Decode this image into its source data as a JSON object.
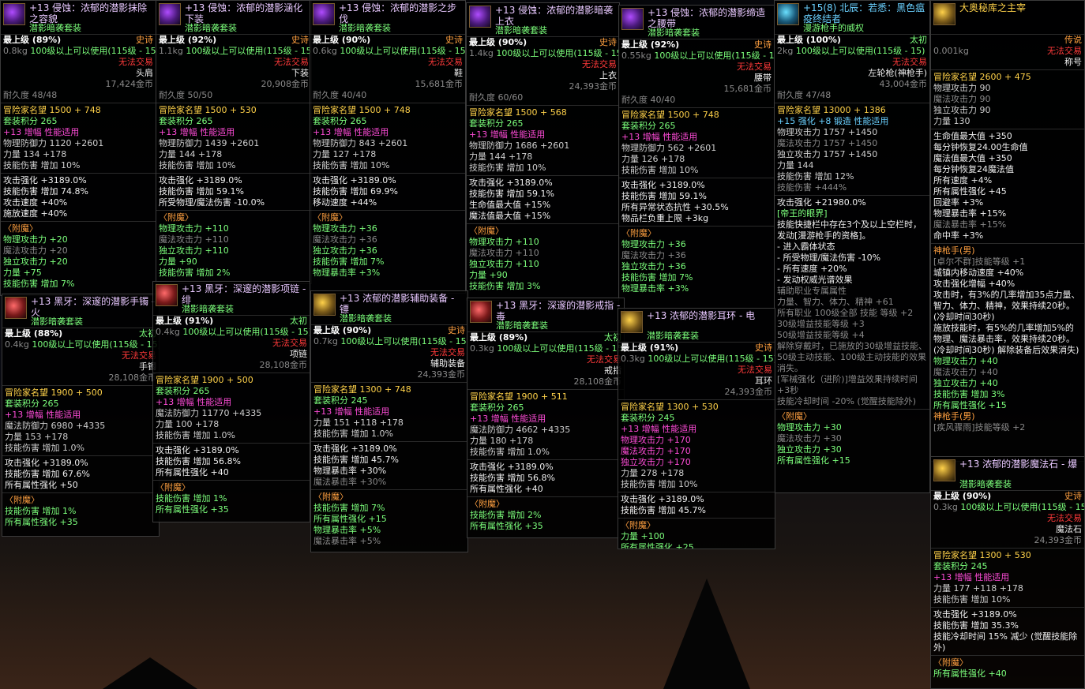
{
  "tooltips": [
    {
      "title": "+13 侵蚀：浓郁的潜影抹除之容貌",
      "set": "潜影暗袭套装",
      "rarity": "史诗",
      "grade": "最上级 (89%)",
      "weight": "0.8kg",
      "req": "100级以上可以使用(115级 - 15)",
      "trade": "无法交易",
      "slot": "头肩",
      "price": "17,424金币",
      "durability": "耐久度 48/48",
      "fame": "冒险家名望 1500 + 748",
      "setpts": "套装积分 265",
      "amp": "+13 增幅 性能适用",
      "def": "物理防御力 1120 +2601",
      "stat": "力量 134 +178",
      "dmg": "技能伤害 增加 10%",
      "b1": "攻击强化 +3189.0%",
      "b2": "技能伤害 增加 74.8%",
      "b3": "攻击速度 +40%",
      "b4": "施放速度 +40%",
      "enchant": "〈附魔〉",
      "e1": "物理攻击力 +20",
      "e2": "魔法攻击力 +20",
      "e3": "独立攻击力 +20",
      "e4": "力量 +75",
      "e5": "技能伤害 增加 7%"
    },
    {
      "title": "+13 侵蚀：浓郁的潜影涵化下装",
      "set": "潜影暗袭套装",
      "rarity": "史诗",
      "grade": "最上级 (92%)",
      "weight": "1.1kg",
      "req": "100级以上可以使用(115级 - 15)",
      "trade": "无法交易",
      "slot": "下装",
      "price": "20,908金币",
      "durability": "耐久度 50/50",
      "fame": "冒险家名望 1500 + 530",
      "setpts": "套装积分 265",
      "amp": "+13 增幅 性能适用",
      "def": "物理防御力 1439 +2601",
      "stat": "力量 144 +178",
      "dmg": "技能伤害 增加 10%",
      "b1": "攻击强化 +3189.0%",
      "b2": "技能伤害 增加 59.1%",
      "b3": "所受物理/魔法伤害 -10.0%",
      "enchant": "〈附魔〉",
      "e1": "物理攻击力 +110",
      "e2": "魔法攻击力 +110",
      "e3": "独立攻击力 +110",
      "e4": "力量 +90",
      "e5": "技能伤害 增加 2%"
    },
    {
      "title": "+13 侵蚀：浓郁的潜影之步伐",
      "set": "潜影暗袭套装",
      "rarity": "史诗",
      "grade": "最上级 (90%)",
      "weight": "0.6kg",
      "req": "100级以上可以使用(115级 - 15)",
      "trade": "无法交易",
      "slot": "鞋",
      "price": "15,681金币",
      "durability": "耐久度 40/40",
      "fame": "冒险家名望 1500 + 748",
      "setpts": "套装积分 265",
      "amp": "+13 增幅 性能适用",
      "def": "物理防御力 843 +2601",
      "stat": "力量 127 +178",
      "dmg": "技能伤害 增加 10%",
      "b1": "攻击强化 +3189.0%",
      "b2": "技能伤害 增加 69.9%",
      "b3": "移动速度 +44%",
      "enchant": "〈附魔〉",
      "e1": "物理攻击力 +36",
      "e2": "魔法攻击力 +36",
      "e3": "独立攻击力 +36",
      "e4": "技能伤害 增加 7%",
      "e5": "物理暴击率 +3%"
    },
    {
      "title": "+13 侵蚀：浓郁的潜影暗袭上衣",
      "set": "潜影暗袭套装",
      "rarity": "史诗",
      "grade": "最上级 (90%)",
      "weight": "1.4kg",
      "req": "100级以上可以使用(115级 - 15)",
      "trade": "无法交易",
      "slot": "上衣",
      "price": "24,393金币",
      "durability": "耐久度 60/60",
      "fame": "冒险家名望 1500 + 568",
      "setpts": "套装积分 265",
      "amp": "+13 增幅 性能适用",
      "def": "物理防御力 1686 +2601",
      "stat": "力量 144 +178",
      "dmg": "技能伤害 增加 10%",
      "b1": "攻击强化 +3189.0%",
      "b2": "技能伤害 增加 59.1%",
      "b3": "生命值最大值 +15%",
      "b4": "魔法值最大值 +15%",
      "enchant": "〈附魔〉",
      "e1": "物理攻击力 +110",
      "e2": "魔法攻击力 +110",
      "e3": "独立攻击力 +110",
      "e4": "力量 +90",
      "e5": "技能伤害 增加 3%"
    },
    {
      "title": "+13 侵蚀：浓郁的潜影缔造之腰带",
      "set": "潜影暗袭套装",
      "rarity": "史诗",
      "grade": "最上级 (92%)",
      "weight": "0.55kg",
      "req": "100级以上可以使用(115级 - 15)",
      "trade": "无法交易",
      "slot": "腰带",
      "price": "15,681金币",
      "durability": "耐久度 40/40",
      "fame": "冒险家名望 1500 + 748",
      "setpts": "套装积分 265",
      "amp": "+13 增幅 性能适用",
      "def": "物理防御力 562 +2601",
      "stat": "力量 126 +178",
      "dmg": "技能伤害 增加 10%",
      "b1": "攻击强化 +3189.0%",
      "b2": "技能伤害 增加 59.1%",
      "b3": "所有异常状态抗性 +30.5%",
      "b4": "物品栏负重上限 +3kg",
      "enchant": "〈附魔〉",
      "e1": "物理攻击力 +36",
      "e2": "魔法攻击力 +36",
      "e3": "独立攻击力 +36",
      "e4": "技能伤害 增加 7%",
      "e5": "物理暴击率 +3%"
    },
    {
      "title": "+15(8) 北辰：若悉：黑色瘟疫终结者",
      "set": "漫游枪手的威权",
      "rarity": "太初",
      "grade": "最上级 (100%)",
      "weight": "2kg",
      "req": "100级以上可以使用(115级 - 15)",
      "trade": "无法交易",
      "slot": "左轮枪(神枪手)",
      "price": "43,004金币",
      "durability": "耐久度 47/48",
      "fame": "冒险家名望 13000 + 1386",
      "l1": "+15 强化 +8 锻造 性能适用",
      "l2": "物理攻击力 1757 +1450",
      "l3": "魔法攻击力 1757 +1450",
      "l4": "独立攻击力 1757 +1450",
      "l5": "力量 144",
      "l6": "技能伤害 增加 12%",
      "l7": "技能伤害 +444%",
      "l8": "攻击强化 +21980.0%",
      "l9": "[帝王的眼界]",
      "l10": "技能快捷栏中存在3个及以上空栏时，发动[漫游枪手的资格]。",
      "l11": "- 进入霸体状态",
      "l12": "- 所受物理/魔法伤害 -10%",
      "l13": "- 所有速度 +20%",
      "l14": "- 发动权威光谱效果",
      "l15": "辅助职业专属属性",
      "l16": "力量、智力、体力、精神 +61",
      "l17": "所有职业 100级全部 技能 等级 +2",
      "l18": "30级增益技能等级 +3",
      "l19": "50级增益技能等级 +4",
      "l20": "解除穿戴时，已施放的30级增益技能、50级主动技能、100级主动技能的效果消失。",
      "l21": "[军械强化（进阶)]增益效果持续时间 +3秒",
      "l22": "技能冷却时间 -20% (觉醒技能除外)",
      "enchant": "〈附魔〉",
      "e1": "物理攻击力 +30",
      "e2": "魔法攻击力 +30",
      "e3": "独立攻击力 +30",
      "e4": "所有属性强化 +15"
    },
    {
      "title": "大奥秘库之主宰",
      "rarity": "传说",
      "weight": "0.001kg",
      "trade": "无法交易",
      "slot": "称号",
      "fame": "冒险家名望 2600 + 475",
      "l1": "物理攻击力 90",
      "l2": "魔法攻击力 90",
      "l3": "独立攻击力 90",
      "l4": "力量 130",
      "l5": "生命值最大值 +350",
      "l6": "每分钟恢复24.00生命值",
      "l7": "魔法值最大值 +350",
      "l8": "每分钟恢复24魔法值",
      "l9": "所有速度 +4%",
      "l10": "所有属性强化 +45",
      "l11": "回避率 +3%",
      "l12": "物理暴击率 +15%",
      "l13": "魔法暴击率 +15%",
      "l14": "命中率 +3%",
      "l15": "神枪手(男)",
      "l16": "[卓尔不群]技能等级 +1",
      "l17": "城镇内移动速度 +40%",
      "l18": "攻击强化增幅 +40%",
      "l19": "攻击时，有3%的几率增加35点力量、智力、体力、精神，效果持续20秒。(冷却时间30秒)",
      "l20": "施放技能时，有5%的几率增加5%的物理、魔法暴击率，效果持续20秒。(冷却时间30秒) 解除装备后效果消失)",
      "e1": "物理攻击力 +40",
      "e2": "魔法攻击力 +40",
      "e3": "独立攻击力 +40",
      "e4": "技能伤害 增加 3%",
      "e5": "所有属性强化 +15",
      "l21": "神枪手(男)",
      "l22": "[疾风骤雨]技能等级 +2"
    },
    {
      "title": "+13 黑牙：深邃的潜影手镯 - 火",
      "set": "潜影暗袭套装",
      "rarity": "太初",
      "grade": "最上级 (88%)",
      "weight": "0.4kg",
      "req": "100级以上可以使用(115级 - 15)",
      "trade": "无法交易",
      "slot": "手镯",
      "price": "28,108金币",
      "fame": "冒险家名望 1900 + 500",
      "setpts": "套装积分 265",
      "amp": "+13 增幅 性能适用",
      "def": "魔法防御力 6980 +4335",
      "stat": "力量 153 +178",
      "dmg": "技能伤害 增加 1.0%",
      "b1": "攻击强化 +3189.0%",
      "b2": "技能伤害 增加 67.6%",
      "b3": "所有属性强化 +50",
      "enchant": "〈附魔〉",
      "e1": "技能伤害 增加 1%",
      "e2": "所有属性强化 +35"
    },
    {
      "title": "+13 黑牙：深邃的潜影项链 - 绯",
      "set": "潜影暗袭套装",
      "rarity": "太初",
      "grade": "最上级 (91%)",
      "weight": "0.4kg",
      "req": "100级以上可以使用(115级 - 15)",
      "trade": "无法交易",
      "slot": "项链",
      "price": "28,108金币",
      "fame": "冒险家名望 1900 + 500",
      "setpts": "套装积分 265",
      "amp": "+13 增幅 性能适用",
      "def": "魔法防御力 11770 +4335",
      "stat": "力量 100 +178",
      "dmg": "技能伤害 增加 1.0%",
      "b1": "攻击强化 +3189.0%",
      "b2": "技能伤害 增加 56.8%",
      "b3": "所有属性强化 +40",
      "enchant": "〈附魔〉",
      "e1": "技能伤害 增加 1%",
      "e2": "所有属性强化 +35"
    },
    {
      "title": "+13 浓郁的潜影辅助装备 - 镖",
      "set": "潜影暗袭套装",
      "rarity": "史诗",
      "grade": "最上级 (90%)",
      "weight": "0.7kg",
      "req": "100级以上可以使用(115级 - 15)",
      "trade": "无法交易",
      "slot": "辅助装备",
      "price": "24,393金币",
      "fame": "冒险家名望 1300 + 748",
      "setpts": "套装积分 245",
      "amp": "+13 增幅 性能适用",
      "def": "力量 151 +118 +178",
      "dmg": "技能伤害 增加 1.0%",
      "b1": "攻击强化 +3189.0%",
      "b2": "技能伤害 增加 45.7%",
      "b3": "物理暴击率 +30%",
      "b4": "魔法暴击率 +30%",
      "enchant": "〈附魔〉",
      "e1": "技能伤害 增加 7%",
      "e2": "所有属性强化 +15",
      "e3": "物理暴击率 +5%",
      "e4": "魔法暴击率 +5%"
    },
    {
      "title": "+13 黑牙：深邃的潜影戒指 - 毒",
      "set": "潜影暗袭套装",
      "rarity": "太初",
      "grade": "最上级 (89%)",
      "weight": "0.3kg",
      "req": "100级以上可以使用(115级 - 15)",
      "trade": "无法交易",
      "slot": "戒指",
      "price": "28,108金币",
      "fame": "冒险家名望 1900 + 511",
      "setpts": "套装积分 265",
      "amp": "+13 增幅 性能适用",
      "def": "魔法防御力 4662 +4335",
      "stat": "力量 180 +178",
      "dmg": "技能伤害 增加 1.0%",
      "b1": "攻击强化 +3189.0%",
      "b2": "技能伤害 增加 56.8%",
      "b3": "所有属性强化 +40",
      "enchant": "〈附魔〉",
      "e1": "技能伤害 增加 2%",
      "e2": "所有属性强化 +35"
    },
    {
      "title": "+13 浓郁的潜影耳环 - 电",
      "set": "潜影暗袭套装",
      "rarity": "史诗",
      "grade": "最上级 (91%)",
      "weight": "0.3kg",
      "req": "100级以上可以使用(115级 - 15)",
      "trade": "无法交易",
      "slot": "耳环",
      "price": "24,393金币",
      "fame": "冒险家名望 1300 + 530",
      "setpts": "套装积分 245",
      "amp": "+13 增幅 性能适用",
      "a1": "物理攻击力 +170",
      "a2": "魔法攻击力 +170",
      "a3": "独立攻击力 +170",
      "stat": "力量 278 +178",
      "dmg": "技能伤害 增加 10%",
      "b1": "攻击强化 +3189.0%",
      "b2": "技能伤害 增加 45.7%",
      "enchant": "〈附魔〉",
      "e1": "力量 +100",
      "e2": "所有属性强化 +25"
    },
    {
      "title": "+13 浓郁的潜影魔法石 - 爆",
      "set": "潜影暗袭套装",
      "rarity": "史诗",
      "grade": "最上级 (90%)",
      "weight": "0.3kg",
      "req": "100级以上可以使用(115级 - 15)",
      "trade": "无法交易",
      "slot": "魔法石",
      "price": "24,393金币",
      "fame": "冒险家名望 1300 + 530",
      "setpts": "套装积分 245",
      "amp": "+13 增幅 性能适用",
      "stat": "力量 177 +118 +178",
      "dmg": "技能伤害 增加 10%",
      "b1": "攻击强化 +3189.0%",
      "b2": "技能伤害 增加 35.3%",
      "b3": "技能冷却时间 15% 减少 (觉醒技能除外)",
      "enchant": "〈附魔〉",
      "e1": "所有属性强化 +40"
    }
  ]
}
